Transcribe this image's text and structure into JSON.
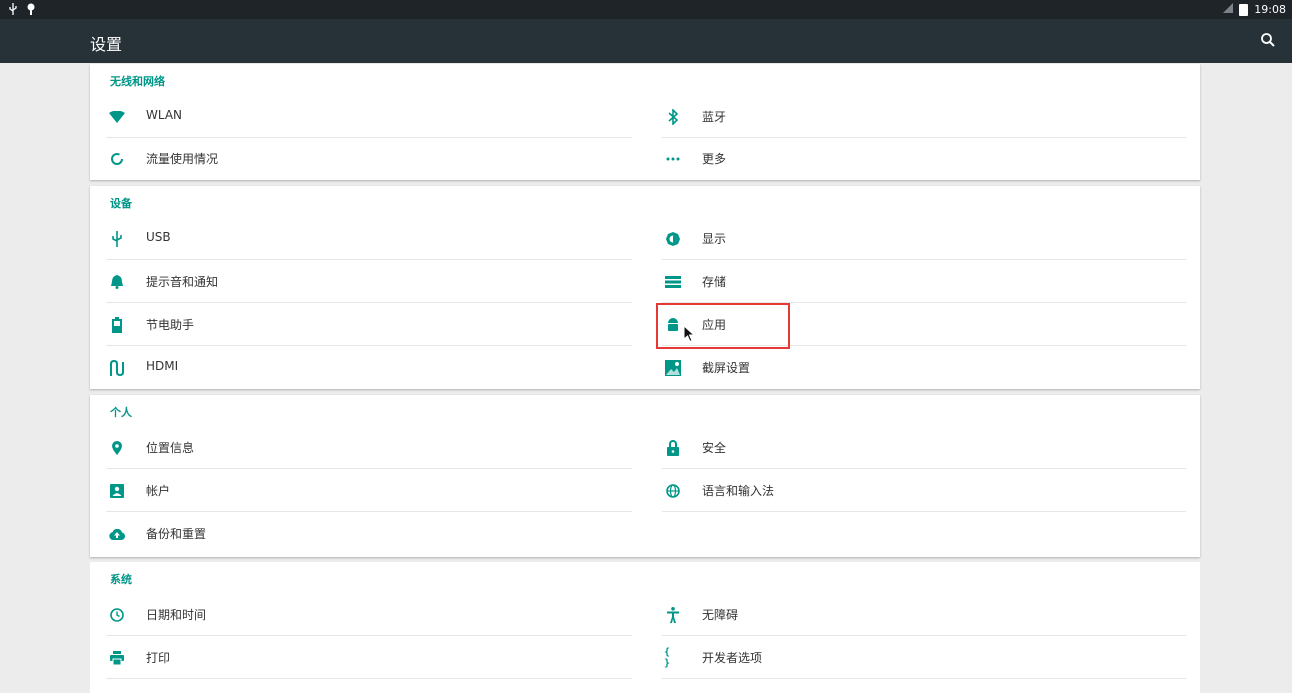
{
  "statusbar": {
    "time": "19:08"
  },
  "appbar": {
    "title": "设置"
  },
  "sections": [
    {
      "title": "无线和网络",
      "items": [
        {
          "label": "WLAN",
          "icon": "wifi-icon"
        },
        {
          "label": "蓝牙",
          "icon": "bluetooth-icon"
        },
        {
          "label": "流量使用情况",
          "icon": "data-usage-icon"
        },
        {
          "label": "更多",
          "icon": "more-icon"
        }
      ]
    },
    {
      "title": "设备",
      "items": [
        {
          "label": "USB",
          "icon": "usb-icon"
        },
        {
          "label": "显示",
          "icon": "brightness-icon"
        },
        {
          "label": "提示音和通知",
          "icon": "bell-icon"
        },
        {
          "label": "存储",
          "icon": "storage-icon"
        },
        {
          "label": "节电助手",
          "icon": "battery-icon"
        },
        {
          "label": "应用",
          "icon": "android-icon"
        },
        {
          "label": "HDMI",
          "icon": "hdmi-icon"
        },
        {
          "label": "截屏设置",
          "icon": "screenshot-icon"
        }
      ]
    },
    {
      "title": "个人",
      "items": [
        {
          "label": "位置信息",
          "icon": "location-icon"
        },
        {
          "label": "安全",
          "icon": "lock-icon"
        },
        {
          "label": "帐户",
          "icon": "account-icon"
        },
        {
          "label": "语言和输入法",
          "icon": "globe-icon"
        },
        {
          "label": "备份和重置",
          "icon": "cloud-upload-icon"
        }
      ]
    },
    {
      "title": "系统",
      "items": [
        {
          "label": "日期和时间",
          "icon": "clock-icon"
        },
        {
          "label": "无障碍",
          "icon": "accessibility-icon"
        },
        {
          "label": "打印",
          "icon": "print-icon"
        },
        {
          "label": "开发者选项",
          "icon": "code-braces-icon"
        }
      ]
    }
  ],
  "colors": {
    "accent": "#009688",
    "appbar": "#263238",
    "statusbar": "#1f2429",
    "highlight": "#e53935"
  }
}
